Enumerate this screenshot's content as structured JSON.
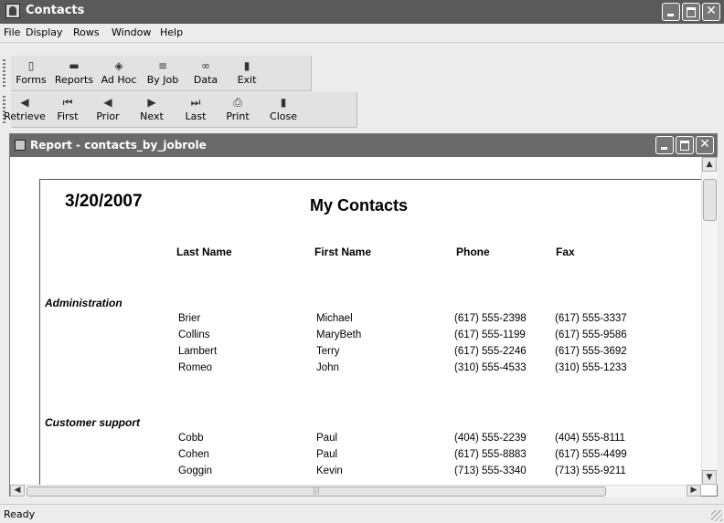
{
  "window": {
    "title": "Contacts"
  },
  "menu": [
    "File",
    "Display",
    "Rows",
    "Window",
    "Help"
  ],
  "toolbar1": [
    {
      "label": "Forms",
      "icon": "clipboard-icon",
      "glyph": "▯"
    },
    {
      "label": "Reports",
      "icon": "report-icon",
      "glyph": "▬"
    },
    {
      "label": "Ad Hoc",
      "icon": "adhoc-icon",
      "glyph": "◈"
    },
    {
      "label": "By Job",
      "icon": "by-job-icon",
      "glyph": "≡"
    },
    {
      "label": "Data",
      "icon": "data-icon",
      "glyph": "∞"
    },
    {
      "label": "Exit",
      "icon": "exit-door-icon",
      "glyph": "▮"
    }
  ],
  "toolbar2": [
    {
      "label": "Retrieve",
      "icon": "retrieve-icon",
      "glyph": "◀"
    },
    {
      "label": "First",
      "icon": "first-icon",
      "glyph": "⏮"
    },
    {
      "label": "Prior",
      "icon": "prior-icon",
      "glyph": "◀"
    },
    {
      "label": "Next",
      "icon": "next-icon",
      "glyph": "▶"
    },
    {
      "label": "Last",
      "icon": "last-icon",
      "glyph": "⏭"
    },
    {
      "label": "Print",
      "icon": "print-icon",
      "glyph": "⎙"
    },
    {
      "label": "Close",
      "icon": "close-door-icon",
      "glyph": "▮"
    }
  ],
  "child_window": {
    "title": "Report - contacts_by_jobrole"
  },
  "report": {
    "date": "3/20/2007",
    "title": "My Contacts",
    "headers": {
      "last": "Last Name",
      "first": "First Name",
      "phone": "Phone",
      "fax": "Fax"
    },
    "groups": [
      {
        "name": "Administration",
        "rows": [
          {
            "last": "Brier",
            "first": "Michael",
            "phone": "(617) 555-2398",
            "fax": "(617) 555-3337"
          },
          {
            "last": "Collins",
            "first": "MaryBeth",
            "phone": "(617) 555-1199",
            "fax": "(617) 555-9586"
          },
          {
            "last": "Lambert",
            "first": "Terry",
            "phone": "(617) 555-2246",
            "fax": "(617) 555-3692"
          },
          {
            "last": "Romeo",
            "first": "John",
            "phone": "(310) 555-4533",
            "fax": "(310) 555-1233"
          }
        ]
      },
      {
        "name": "Customer support",
        "rows": [
          {
            "last": "Cobb",
            "first": "Paul",
            "phone": "(404) 555-2239",
            "fax": "(404) 555-8111"
          },
          {
            "last": "Cohen",
            "first": "Paul",
            "phone": "(617) 555-8883",
            "fax": "(617) 555-4499"
          },
          {
            "last": "Goggin",
            "first": "Kevin",
            "phone": "(713) 555-3340",
            "fax": "(713) 555-9211"
          }
        ]
      }
    ]
  },
  "status": {
    "text": "Ready"
  }
}
